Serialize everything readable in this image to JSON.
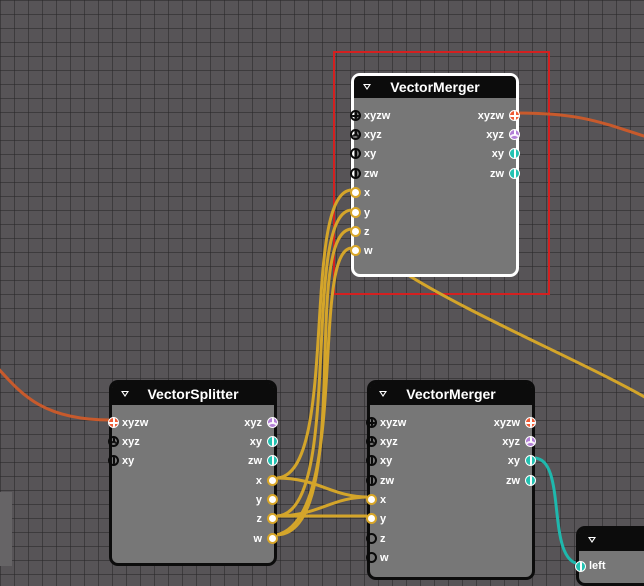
{
  "nodes": {
    "merger_top": {
      "title": "VectorMerger",
      "inputs": [
        {
          "label": "xyzw"
        },
        {
          "label": "xyz"
        },
        {
          "label": "xy"
        },
        {
          "label": "zw"
        },
        {
          "label": "x"
        },
        {
          "label": "y"
        },
        {
          "label": "z"
        },
        {
          "label": "w"
        }
      ],
      "outputs": [
        {
          "label": "xyzw"
        },
        {
          "label": "xyz"
        },
        {
          "label": "xy"
        },
        {
          "label": "zw"
        }
      ]
    },
    "splitter": {
      "title": "VectorSplitter",
      "inputs": [
        {
          "label": "xyzw"
        },
        {
          "label": "xyz"
        },
        {
          "label": "xy"
        }
      ],
      "outputs": [
        {
          "label": "xyz"
        },
        {
          "label": "xy"
        },
        {
          "label": "zw"
        },
        {
          "label": "x"
        },
        {
          "label": "y"
        },
        {
          "label": "z"
        },
        {
          "label": "w"
        }
      ]
    },
    "merger_bottom": {
      "title": "VectorMerger",
      "inputs": [
        {
          "label": "xyzw"
        },
        {
          "label": "xyz"
        },
        {
          "label": "xy"
        },
        {
          "label": "zw"
        },
        {
          "label": "x"
        },
        {
          "label": "y"
        },
        {
          "label": "z"
        },
        {
          "label": "w"
        }
      ],
      "outputs": [
        {
          "label": "xyzw"
        },
        {
          "label": "xyz"
        },
        {
          "label": "xy"
        },
        {
          "label": "zw"
        }
      ]
    },
    "partial": {
      "title": "",
      "inputs": [
        {
          "label": "left"
        }
      ]
    }
  },
  "colors": {
    "wire_orange": "#c85a2c",
    "wire_yellow": "#d4a52a",
    "wire_teal": "#1fb8ad",
    "selection": "#d42020"
  }
}
